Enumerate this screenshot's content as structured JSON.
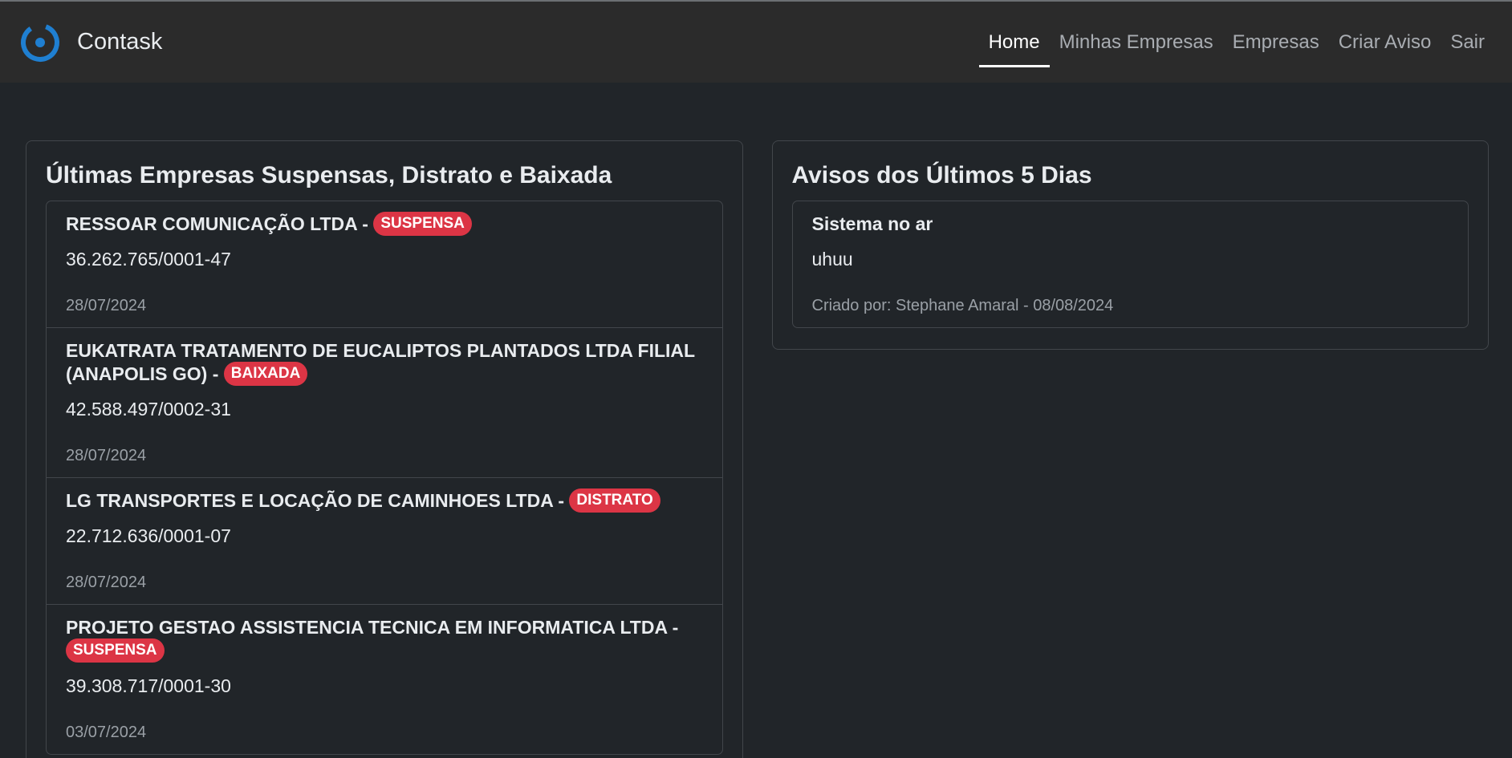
{
  "app": {
    "name": "Contask",
    "logo_color": "#1f7fd1"
  },
  "nav": {
    "items": [
      {
        "label": "Home",
        "active": true
      },
      {
        "label": "Minhas Empresas",
        "active": false
      },
      {
        "label": "Empresas",
        "active": false
      },
      {
        "label": "Criar Aviso",
        "active": false
      },
      {
        "label": "Sair",
        "active": false
      }
    ]
  },
  "left_card": {
    "title": "Últimas Empresas Suspensas, Distrato e Baixada",
    "items": [
      {
        "name": "RESSOAR COMUNICAÇÃO LTDA -",
        "status": "SUSPENSA",
        "cnpj": "36.262.765/0001-47",
        "date": "28/07/2024"
      },
      {
        "name": "EUKATRATA TRATAMENTO DE EUCALIPTOS PLANTADOS LTDA FILIAL (ANAPOLIS GO) -",
        "status": "BAIXADA",
        "cnpj": "42.588.497/0002-31",
        "date": "28/07/2024"
      },
      {
        "name": "LG TRANSPORTES E LOCAÇÃO DE CAMINHOES LTDA -",
        "status": "DISTRATO",
        "cnpj": "22.712.636/0001-07",
        "date": "28/07/2024"
      },
      {
        "name": "PROJETO GESTAO ASSISTENCIA TECNICA EM INFORMATICA LTDA -",
        "status": "SUSPENSA",
        "cnpj": "39.308.717/0001-30",
        "date": "03/07/2024"
      }
    ]
  },
  "right_card": {
    "title": "Avisos dos Últimos 5 Dias",
    "notices": [
      {
        "title": "Sistema no ar",
        "body": "uhuu",
        "meta": "Criado por: Stephane Amaral - 08/08/2024"
      }
    ]
  },
  "colors": {
    "badge": "#dc3545",
    "background": "#212529",
    "navbar": "#2b2b2b"
  }
}
